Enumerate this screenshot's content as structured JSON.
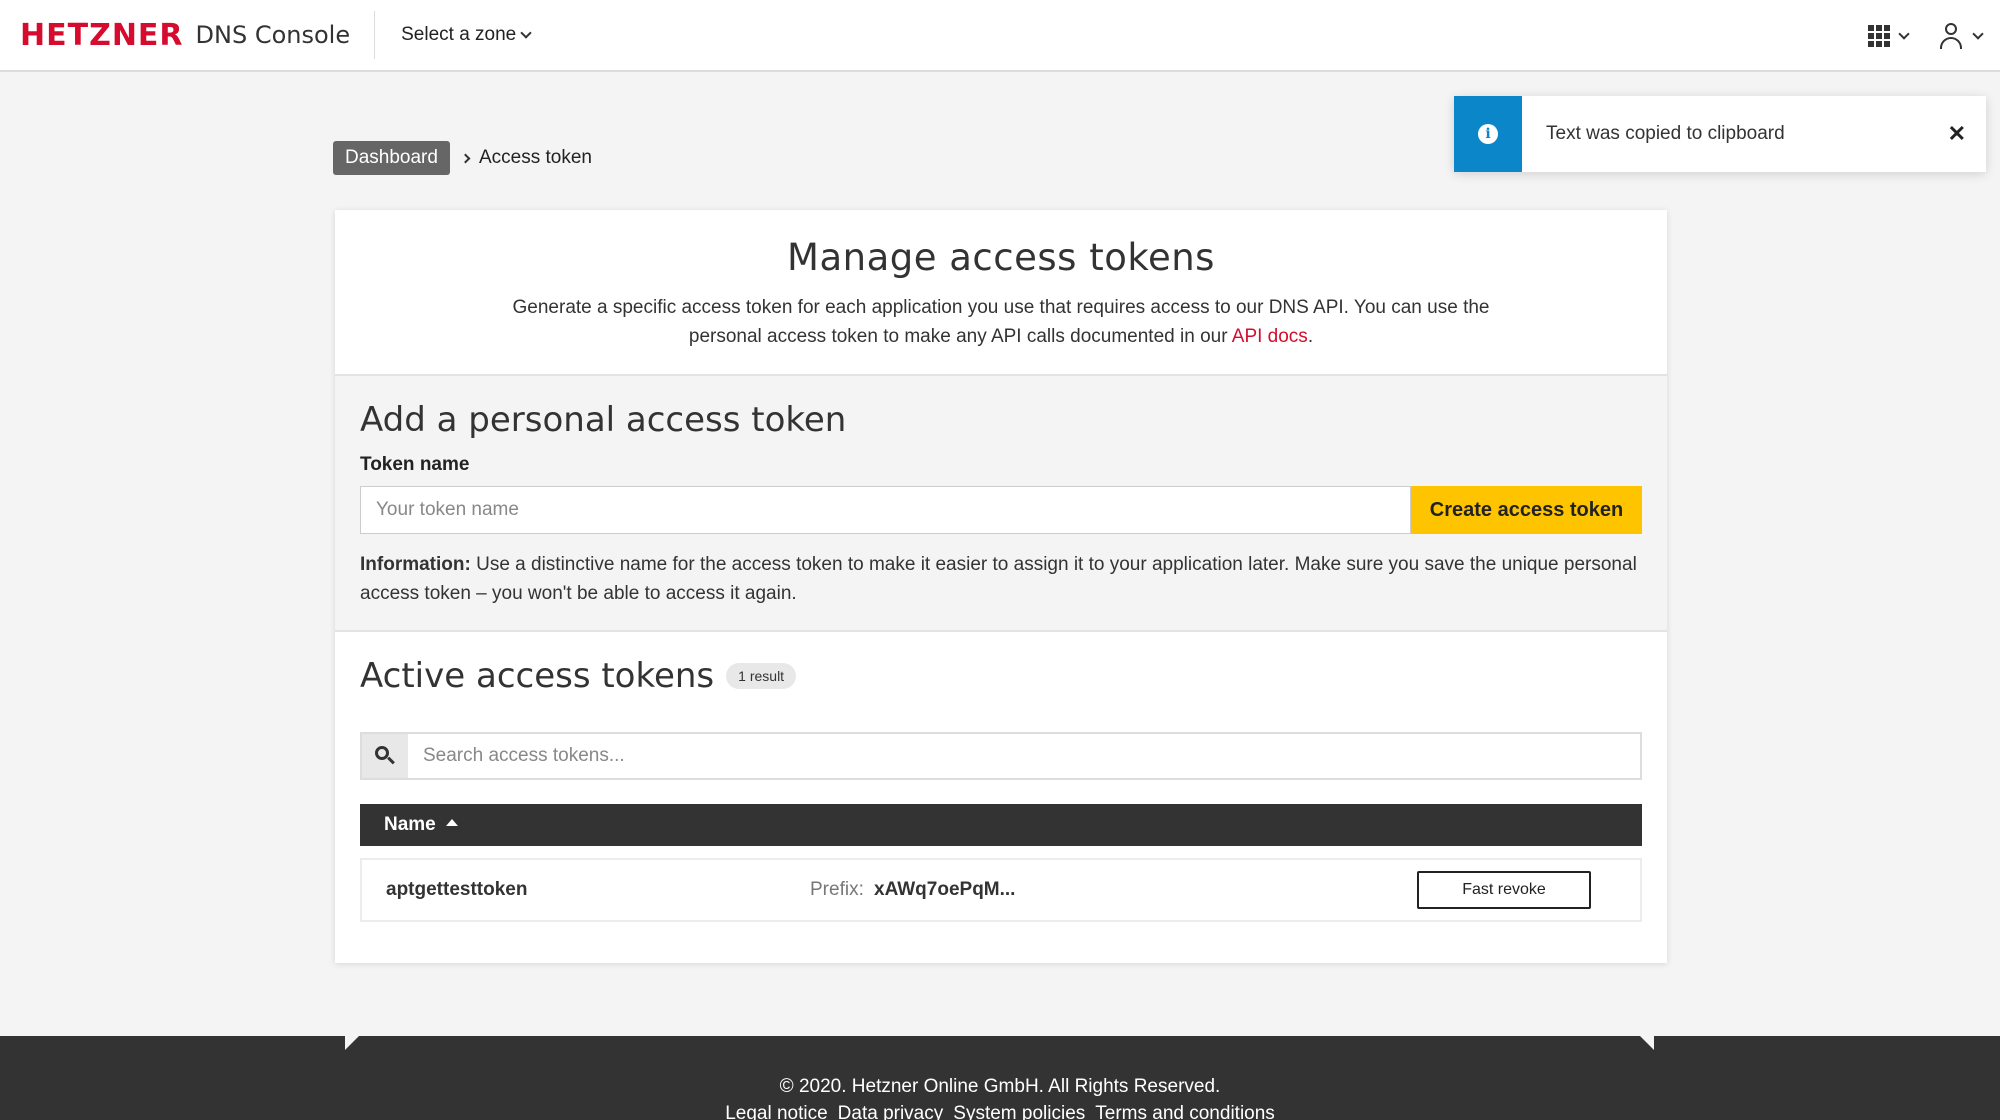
{
  "header": {
    "logo": "HETZNER",
    "app_title": "DNS Console",
    "zone_select": "Select a zone"
  },
  "toast": {
    "message": "Text was copied to clipboard",
    "close_symbol": "✕",
    "color": "#0a86c9"
  },
  "breadcrumb": {
    "home": "Dashboard",
    "current": "Access token"
  },
  "manage": {
    "title": "Manage access tokens",
    "desc_before": "Generate a specific access token for each application you use that requires access to our DNS API. You can use the personal access token to make any API calls documented in our ",
    "desc_link": "API docs",
    "desc_after": "."
  },
  "add": {
    "title": "Add a personal access token",
    "label": "Token name",
    "placeholder": "Your token name",
    "button": "Create access token",
    "info_label": "Information:",
    "info_text": " Use a distinctive name for the access token to make it easier to assign it to your application later. Make sure you save the unique personal access token – you won't be able to access it again."
  },
  "active": {
    "title": "Active access tokens",
    "badge": "1 result",
    "search_placeholder": "Search access tokens...",
    "column_name": "Name",
    "rows": [
      {
        "name": "aptgettesttoken",
        "prefix_label": "Prefix:",
        "prefix": "xAWq7oePqM...",
        "action": "Fast revoke"
      }
    ]
  },
  "footer": {
    "copyright": "© 2020. Hetzner Online GmbH. All Rights Reserved.",
    "links": [
      "Legal notice",
      "Data privacy",
      "System policies",
      "Terms and conditions"
    ]
  },
  "colors": {
    "brand": "#d50c2d",
    "primary_button": "#ffc400",
    "info": "#0a86c9"
  }
}
